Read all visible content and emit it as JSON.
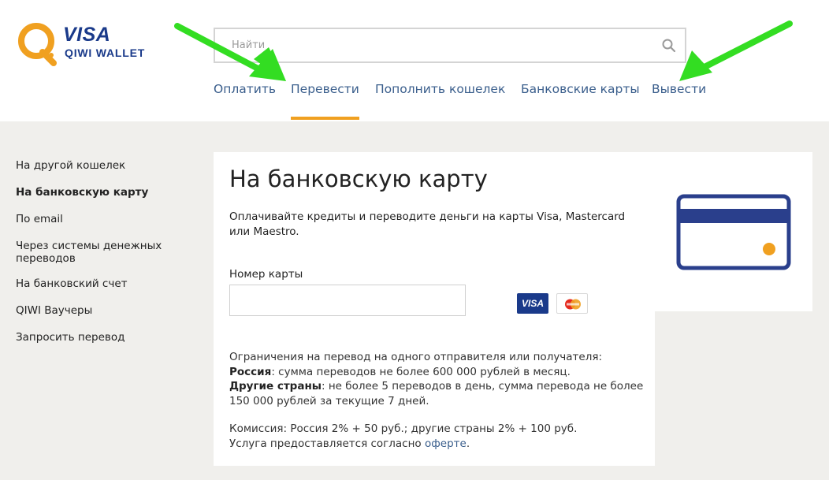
{
  "brand": {
    "visa": "VISA",
    "wallet": "QIWI WALLET"
  },
  "search": {
    "placeholder": "Найти"
  },
  "nav": [
    {
      "label": "Оплатить",
      "active": false
    },
    {
      "label": "Перевести",
      "active": true
    },
    {
      "label": "Пополнить кошелек",
      "active": false
    },
    {
      "label": "Банковские карты",
      "active": false
    },
    {
      "label": "Вывести",
      "active": false
    }
  ],
  "sidebar": [
    {
      "label": "На другой кошелек",
      "active": false
    },
    {
      "label": "На банковскую карту",
      "active": true
    },
    {
      "label": "По email",
      "active": false
    },
    {
      "label": "Через системы денежных переводов",
      "active": false
    },
    {
      "label": "На банковский счет",
      "active": false
    },
    {
      "label": "QIWI Ваучеры",
      "active": false
    },
    {
      "label": "Запросить перевод",
      "active": false
    }
  ],
  "main": {
    "title": "На банковскую карту",
    "description": "Оплачивайте кредиты и переводите деньги на карты Visa, Mastercard или Maestro.",
    "card_number_label": "Номер карты",
    "card_number_value": "",
    "payment_badges": [
      "VISA",
      "Mastercard"
    ],
    "limits_title": "Ограничения на перевод на одного отправителя или получателя:",
    "russia_label": "Россия",
    "russia_text": ": сумма переводов не более 600 000 рублей в месяц.",
    "other_label": "Другие страны",
    "other_text": ": не более 5 переводов в день, сумма перевода не более 150 000 рублей за текущие 7 дней.",
    "commission_text": "Комиссия: Россия 2% + 50 руб.; другие страны 2% + 100 руб.",
    "offer_prefix": "Услуга предоставляется согласно ",
    "offer_link": "оферте",
    "offer_suffix": "."
  },
  "colors": {
    "accent": "#f0a020",
    "brand_blue": "#1a3a8a",
    "link": "#3a5e8c",
    "annotation_arrow": "#33dd22"
  }
}
